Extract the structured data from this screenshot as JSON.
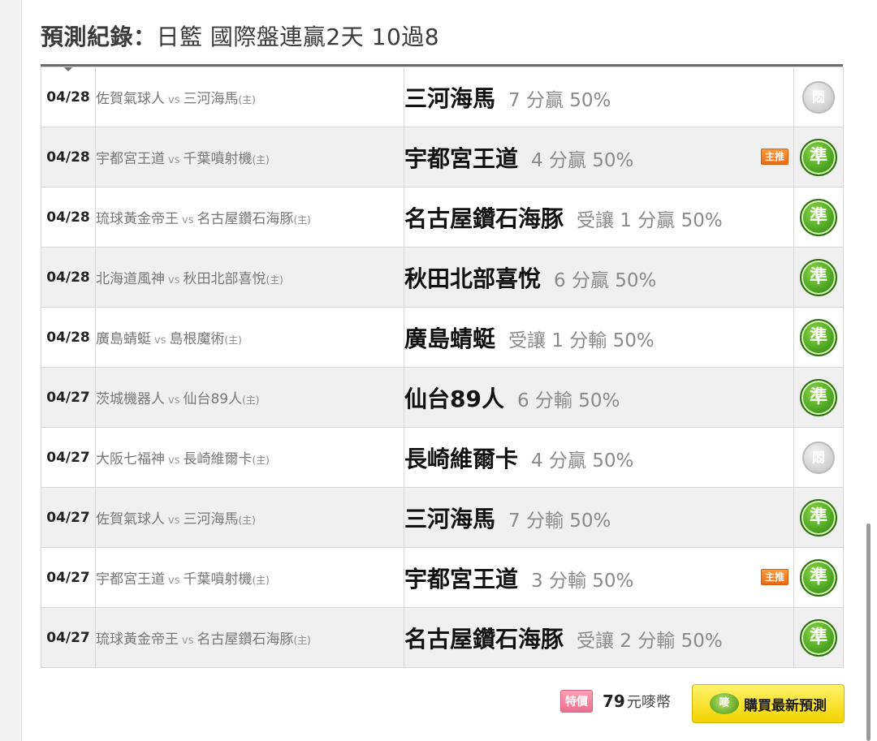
{
  "header": {
    "title_lead": "預測紀錄：",
    "title_rest": "日籃 國際盤連贏2天 10過8"
  },
  "records": [
    {
      "date": "04/28",
      "away": "佐賀氣球人",
      "vs": "vs",
      "home": "三河海馬",
      "home_tag": "(主)",
      "pick_team": "三河海馬",
      "pick_detail": "7 分贏 50%",
      "badge": "",
      "result": "unknown",
      "result_label": "悶"
    },
    {
      "date": "04/28",
      "away": "宇都宮王道",
      "vs": "vs",
      "home": "千葉噴射機",
      "home_tag": "(主)",
      "pick_team": "宇都宮王道",
      "pick_detail": "4 分贏 50%",
      "badge": "主推",
      "result": "win",
      "result_label": "準"
    },
    {
      "date": "04/28",
      "away": "琉球黃金帝王",
      "vs": "vs",
      "home": "名古屋鑽石海豚",
      "home_tag": "(主)",
      "pick_team": "名古屋鑽石海豚",
      "pick_detail": "受讓 1 分贏 50%",
      "badge": "",
      "result": "win",
      "result_label": "準"
    },
    {
      "date": "04/28",
      "away": "北海道風神",
      "vs": "vs",
      "home": "秋田北部喜悅",
      "home_tag": "(主)",
      "pick_team": "秋田北部喜悅",
      "pick_detail": "6 分贏 50%",
      "badge": "",
      "result": "win",
      "result_label": "準"
    },
    {
      "date": "04/28",
      "away": "廣島蜻蜓",
      "vs": "vs",
      "home": "島根魔術",
      "home_tag": "(主)",
      "pick_team": "廣島蜻蜓",
      "pick_detail": "受讓 1 分輸 50%",
      "badge": "",
      "result": "win",
      "result_label": "準"
    },
    {
      "date": "04/27",
      "away": "茨城機器人",
      "vs": "vs",
      "home": "仙台89人",
      "home_tag": "(主)",
      "pick_team": "仙台89人",
      "pick_detail": "6 分輸 50%",
      "badge": "",
      "result": "win",
      "result_label": "準"
    },
    {
      "date": "04/27",
      "away": "大阪七福神",
      "vs": "vs",
      "home": "長崎維爾卡",
      "home_tag": "(主)",
      "pick_team": "長崎維爾卡",
      "pick_detail": "4 分贏 50%",
      "badge": "",
      "result": "unknown",
      "result_label": "悶"
    },
    {
      "date": "04/27",
      "away": "佐賀氣球人",
      "vs": "vs",
      "home": "三河海馬",
      "home_tag": "(主)",
      "pick_team": "三河海馬",
      "pick_detail": "7 分輸 50%",
      "badge": "",
      "result": "win",
      "result_label": "準"
    },
    {
      "date": "04/27",
      "away": "宇都宮王道",
      "vs": "vs",
      "home": "千葉噴射機",
      "home_tag": "(主)",
      "pick_team": "宇都宮王道",
      "pick_detail": "3 分輸 50%",
      "badge": "主推",
      "result": "win",
      "result_label": "準"
    },
    {
      "date": "04/27",
      "away": "琉球黃金帝王",
      "vs": "vs",
      "home": "名古屋鑽石海豚",
      "home_tag": "(主)",
      "pick_team": "名古屋鑽石海豚",
      "pick_detail": "受讓 2 分輸 50%",
      "badge": "",
      "result": "win",
      "result_label": "準"
    }
  ],
  "footer": {
    "special_label": "特價",
    "price": "79",
    "currency": "元嘜幣",
    "buy_icon_text": "嘜",
    "buy_label": "購買最新預測"
  },
  "colors": {
    "win_icon": "#4fa824",
    "unknown_icon": "#cfcfcf",
    "badge": "#e96a12",
    "buy_button": "#f3d300",
    "special_tag": "#e9708e"
  },
  "icons": {
    "result_win": "green-circle-準-icon",
    "result_unknown": "gray-circle-悶-icon",
    "buy": "maimai-coin-icon"
  }
}
